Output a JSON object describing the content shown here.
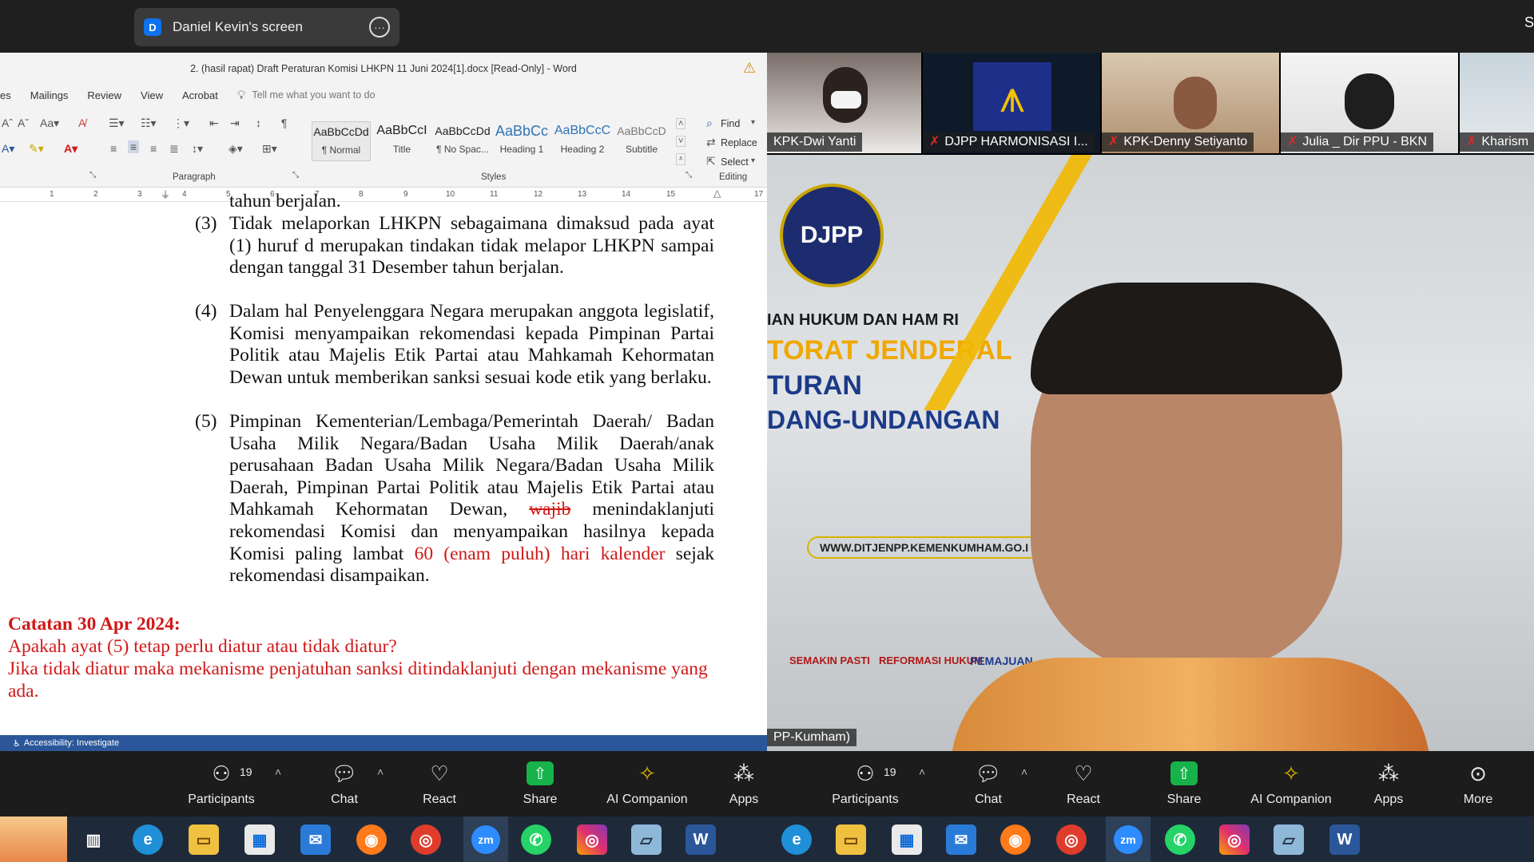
{
  "top": {
    "share_label": "Daniel Kevin's screen",
    "avatar_letter": "D",
    "right_partial": "S"
  },
  "word": {
    "title": "2. (hasil rapat) Draft Peraturan Komisi LHKPN 11 Juni 2024[1].docx [Read-Only]  -  Word",
    "tabs": [
      "es",
      "Mailings",
      "Review",
      "View",
      "Acrobat"
    ],
    "tell_me": "Tell me what you want to do",
    "groups": {
      "paragraph": "Paragraph",
      "styles": "Styles",
      "editing": "Editing"
    },
    "styles": [
      {
        "sample": "AaBbCcDd",
        "name": "¶ Normal"
      },
      {
        "sample": "AaBbCcI",
        "name": "Title"
      },
      {
        "sample": "AaBbCcDd",
        "name": "¶ No Spac..."
      },
      {
        "sample": "AaBbCc",
        "name": "Heading 1"
      },
      {
        "sample": "AaBbCcC",
        "name": "Heading 2"
      },
      {
        "sample": "AaBbCcD",
        "name": "Subtitle"
      }
    ],
    "editing": {
      "find": "Find",
      "replace": "Replace",
      "select": "Select"
    },
    "ruler_ticks": [
      "1",
      "2",
      "3",
      "4",
      "5",
      "6",
      "7",
      "8",
      "9",
      "10",
      "11",
      "12",
      "13",
      "14",
      "15",
      "17"
    ],
    "status": "Accessibility: Investigate"
  },
  "doc": {
    "top_fragment": "tahun berjalan.",
    "p3_num": "(3)",
    "p3": "Tidak melaporkan LHKPN sebagaimana dimaksud pada ayat (1) huruf d merupakan tindakan tidak melapor LHKPN sampai dengan tanggal 31 Desember tahun berjalan.",
    "p4_num": "(4)",
    "p4": "Dalam hal Penyelenggara Negara merupakan anggota legislatif, Komisi menyampaikan rekomendasi kepada Pimpinan Partai Politik atau Majelis Etik Partai atau Mahkamah Kehormatan Dewan untuk memberikan sanksi sesuai kode etik yang berlaku.",
    "p5_num": "(5)",
    "p5_a": "Pimpinan Kementerian/Lembaga/Pemerintah Daerah/ Badan Usaha Milik Negara/Badan Usaha Milik Daerah/anak perusahaan Badan Usaha Milik Negara/Badan Usaha Milik Daerah, Pimpinan Partai Politik atau Majelis Etik Partai atau Mahkamah Kehormatan Dewan,",
    "p5_strike": "wajib",
    "p5_b": "menindaklanjuti rekomendasi Komisi dan menyampaikan hasilnya kepada Komisi paling lambat",
    "p5_red": "60 (enam puluh) hari kalender",
    "p5_c": "sejak rekomendasi disampaikan.",
    "note_head": "Catatan 30 Apr 2024:",
    "note_1": "Apakah ayat (5) tetap perlu diatur atau tidak diatur?",
    "note_2": "Jika tidak diatur maka mekanisme penjatuhan sanksi ditindaklanjuti dengan mekanisme yang ada."
  },
  "participants": [
    {
      "name": "KPK-Dwi Yanti"
    },
    {
      "name": "DJPP HARMONISASI I..."
    },
    {
      "name": "KPK-Denny Setiyanto"
    },
    {
      "name": "Julia _ Dir PPU - BKN"
    },
    {
      "name": "Kharism"
    }
  ],
  "speaker": {
    "name": "PP-Kumham)",
    "logo": "DJPP",
    "bg_line1": "IAN HUKUM DAN HAM RI",
    "bg_line2": "TORAT JENDERAL",
    "bg_line3": "TURAN",
    "bg_line4": "DANG-UNDANGAN",
    "bg_url": "WWW.DITJENPP.KEMENKUMHAM.GO.I",
    "bg_badges": [
      "SEMAKIN PASTI",
      "REFORMASI HUKUM",
      "PEMAJUAN"
    ]
  },
  "controls_left": [
    {
      "label": "Participants",
      "count": "19"
    },
    {
      "label": "Chat"
    },
    {
      "label": "React"
    },
    {
      "label": "Share"
    },
    {
      "label": "AI Companion"
    },
    {
      "label": "Apps"
    }
  ],
  "controls_right": [
    {
      "label": "Participants",
      "count": "19"
    },
    {
      "label": "Chat"
    },
    {
      "label": "React"
    },
    {
      "label": "Share"
    },
    {
      "label": "AI Companion"
    },
    {
      "label": "Apps"
    },
    {
      "label": "More"
    }
  ],
  "taskbar_apps": [
    "Edge",
    "File Explorer",
    "Microsoft Store",
    "Mail",
    "Firefox",
    "Chrome",
    "Zoom",
    "WhatsApp",
    "Instagram",
    "Notes",
    "Word"
  ],
  "taskbar_labels": {
    "zoom": "zm",
    "word": "W"
  },
  "colors": {
    "word_blue": "#2b579a",
    "red_text": "#d01818",
    "zoom_share_green": "#17b34a",
    "mic_off": "#e02828"
  }
}
